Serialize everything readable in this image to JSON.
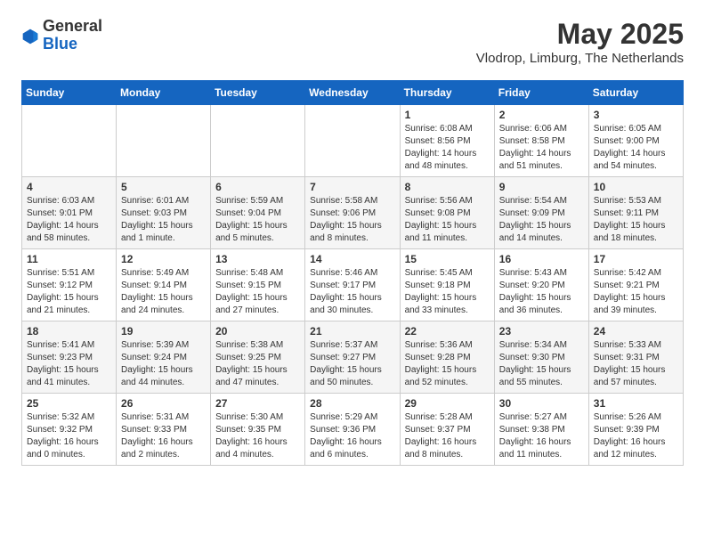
{
  "header": {
    "logo": {
      "general": "General",
      "blue": "Blue"
    },
    "title": "May 2025",
    "location": "Vlodrop, Limburg, The Netherlands"
  },
  "calendar": {
    "days": [
      "Sunday",
      "Monday",
      "Tuesday",
      "Wednesday",
      "Thursday",
      "Friday",
      "Saturday"
    ],
    "weeks": [
      [
        {
          "day": "",
          "info": ""
        },
        {
          "day": "",
          "info": ""
        },
        {
          "day": "",
          "info": ""
        },
        {
          "day": "",
          "info": ""
        },
        {
          "day": "1",
          "info": "Sunrise: 6:08 AM\nSunset: 8:56 PM\nDaylight: 14 hours\nand 48 minutes."
        },
        {
          "day": "2",
          "info": "Sunrise: 6:06 AM\nSunset: 8:58 PM\nDaylight: 14 hours\nand 51 minutes."
        },
        {
          "day": "3",
          "info": "Sunrise: 6:05 AM\nSunset: 9:00 PM\nDaylight: 14 hours\nand 54 minutes."
        }
      ],
      [
        {
          "day": "4",
          "info": "Sunrise: 6:03 AM\nSunset: 9:01 PM\nDaylight: 14 hours\nand 58 minutes."
        },
        {
          "day": "5",
          "info": "Sunrise: 6:01 AM\nSunset: 9:03 PM\nDaylight: 15 hours\nand 1 minute."
        },
        {
          "day": "6",
          "info": "Sunrise: 5:59 AM\nSunset: 9:04 PM\nDaylight: 15 hours\nand 5 minutes."
        },
        {
          "day": "7",
          "info": "Sunrise: 5:58 AM\nSunset: 9:06 PM\nDaylight: 15 hours\nand 8 minutes."
        },
        {
          "day": "8",
          "info": "Sunrise: 5:56 AM\nSunset: 9:08 PM\nDaylight: 15 hours\nand 11 minutes."
        },
        {
          "day": "9",
          "info": "Sunrise: 5:54 AM\nSunset: 9:09 PM\nDaylight: 15 hours\nand 14 minutes."
        },
        {
          "day": "10",
          "info": "Sunrise: 5:53 AM\nSunset: 9:11 PM\nDaylight: 15 hours\nand 18 minutes."
        }
      ],
      [
        {
          "day": "11",
          "info": "Sunrise: 5:51 AM\nSunset: 9:12 PM\nDaylight: 15 hours\nand 21 minutes."
        },
        {
          "day": "12",
          "info": "Sunrise: 5:49 AM\nSunset: 9:14 PM\nDaylight: 15 hours\nand 24 minutes."
        },
        {
          "day": "13",
          "info": "Sunrise: 5:48 AM\nSunset: 9:15 PM\nDaylight: 15 hours\nand 27 minutes."
        },
        {
          "day": "14",
          "info": "Sunrise: 5:46 AM\nSunset: 9:17 PM\nDaylight: 15 hours\nand 30 minutes."
        },
        {
          "day": "15",
          "info": "Sunrise: 5:45 AM\nSunset: 9:18 PM\nDaylight: 15 hours\nand 33 minutes."
        },
        {
          "day": "16",
          "info": "Sunrise: 5:43 AM\nSunset: 9:20 PM\nDaylight: 15 hours\nand 36 minutes."
        },
        {
          "day": "17",
          "info": "Sunrise: 5:42 AM\nSunset: 9:21 PM\nDaylight: 15 hours\nand 39 minutes."
        }
      ],
      [
        {
          "day": "18",
          "info": "Sunrise: 5:41 AM\nSunset: 9:23 PM\nDaylight: 15 hours\nand 41 minutes."
        },
        {
          "day": "19",
          "info": "Sunrise: 5:39 AM\nSunset: 9:24 PM\nDaylight: 15 hours\nand 44 minutes."
        },
        {
          "day": "20",
          "info": "Sunrise: 5:38 AM\nSunset: 9:25 PM\nDaylight: 15 hours\nand 47 minutes."
        },
        {
          "day": "21",
          "info": "Sunrise: 5:37 AM\nSunset: 9:27 PM\nDaylight: 15 hours\nand 50 minutes."
        },
        {
          "day": "22",
          "info": "Sunrise: 5:36 AM\nSunset: 9:28 PM\nDaylight: 15 hours\nand 52 minutes."
        },
        {
          "day": "23",
          "info": "Sunrise: 5:34 AM\nSunset: 9:30 PM\nDaylight: 15 hours\nand 55 minutes."
        },
        {
          "day": "24",
          "info": "Sunrise: 5:33 AM\nSunset: 9:31 PM\nDaylight: 15 hours\nand 57 minutes."
        }
      ],
      [
        {
          "day": "25",
          "info": "Sunrise: 5:32 AM\nSunset: 9:32 PM\nDaylight: 16 hours\nand 0 minutes."
        },
        {
          "day": "26",
          "info": "Sunrise: 5:31 AM\nSunset: 9:33 PM\nDaylight: 16 hours\nand 2 minutes."
        },
        {
          "day": "27",
          "info": "Sunrise: 5:30 AM\nSunset: 9:35 PM\nDaylight: 16 hours\nand 4 minutes."
        },
        {
          "day": "28",
          "info": "Sunrise: 5:29 AM\nSunset: 9:36 PM\nDaylight: 16 hours\nand 6 minutes."
        },
        {
          "day": "29",
          "info": "Sunrise: 5:28 AM\nSunset: 9:37 PM\nDaylight: 16 hours\nand 8 minutes."
        },
        {
          "day": "30",
          "info": "Sunrise: 5:27 AM\nSunset: 9:38 PM\nDaylight: 16 hours\nand 11 minutes."
        },
        {
          "day": "31",
          "info": "Sunrise: 5:26 AM\nSunset: 9:39 PM\nDaylight: 16 hours\nand 12 minutes."
        }
      ]
    ]
  }
}
